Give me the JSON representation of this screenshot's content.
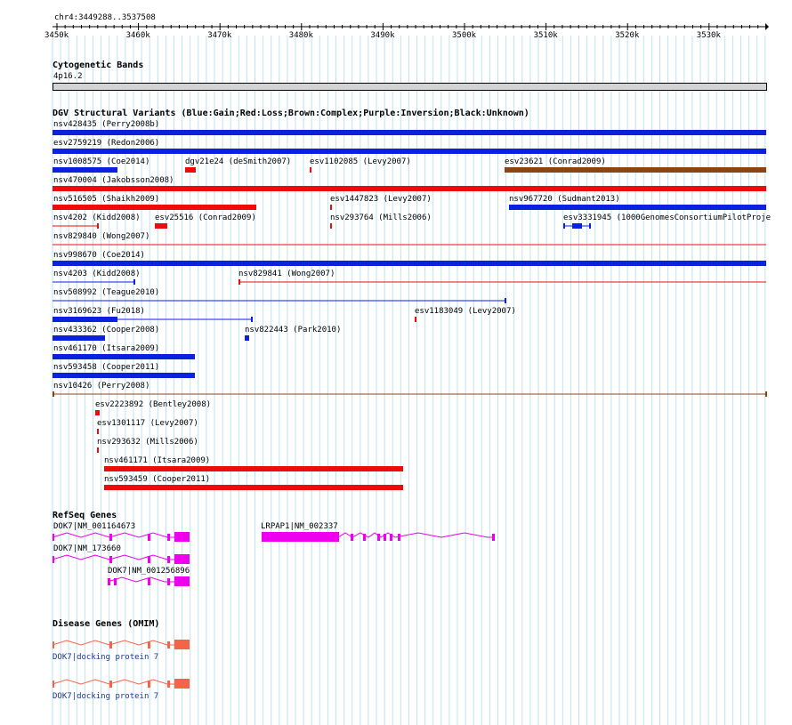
{
  "region": "chr4:3449288..3537508",
  "ruler": {
    "ticks": [
      "3450k",
      "3460k",
      "3470k",
      "3480k",
      "3490k",
      "3500k",
      "3510k",
      "3520k",
      "3530k"
    ]
  },
  "cytoband": {
    "title": "Cytogenetic Bands",
    "band": "4p16.2"
  },
  "dgv": {
    "title": "DGV Structural Variants (Blue:Gain;Red:Loss;Brown:Complex;Purple:Inversion;Black:Unknown)",
    "legend_colors": {
      "gain": "#0a22e0",
      "loss": "#ee0b0b",
      "complex": "#8b4513",
      "inversion": "#800080",
      "unknown": "#000000"
    },
    "variants": [
      {
        "label": "nsv428435 (Perry2008b)",
        "type": "gain"
      },
      {
        "label": "esv2759219 (Redon2006)",
        "type": "gain"
      },
      {
        "label": "nsv1008575 (Coe2014)",
        "type": "gain"
      },
      {
        "label": "dgv21e24 (deSmith2007)",
        "type": "loss"
      },
      {
        "label": "esv1102085 (Levy2007)",
        "type": "loss"
      },
      {
        "label": "esv23621 (Conrad2009)",
        "type": "complex"
      },
      {
        "label": "nsv470004 (Jakobsson2008)",
        "type": "loss"
      },
      {
        "label": "nsv516505 (Shaikh2009)",
        "type": "loss"
      },
      {
        "label": "esv1447823 (Levy2007)",
        "type": "loss"
      },
      {
        "label": "nsv967720 (Sudmant2013)",
        "type": "gain"
      },
      {
        "label": "nsv4202 (Kidd2008)",
        "type": "loss"
      },
      {
        "label": "esv25516 (Conrad2009)",
        "type": "loss"
      },
      {
        "label": "nsv293764 (Mills2006)",
        "type": "loss"
      },
      {
        "label": "esv3331945 (1000GenomesConsortiumPilotProje",
        "type": "gain"
      },
      {
        "label": "nsv829840 (Wong2007)",
        "type": "loss"
      },
      {
        "label": "nsv998670 (Coe2014)",
        "type": "gain"
      },
      {
        "label": "nsv4203 (Kidd2008)",
        "type": "gain"
      },
      {
        "label": "nsv829841 (Wong2007)",
        "type": "loss"
      },
      {
        "label": "nsv508992 (Teague2010)",
        "type": "gain"
      },
      {
        "label": "nsv3169623 (Fu2018)",
        "type": "gain"
      },
      {
        "label": "esv1183049 (Levy2007)",
        "type": "loss"
      },
      {
        "label": "nsv433362 (Cooper2008)",
        "type": "gain"
      },
      {
        "label": "nsv822443 (Park2010)",
        "type": "gain"
      },
      {
        "label": "nsv461170 (Itsara2009)",
        "type": "gain"
      },
      {
        "label": "nsv593458 (Cooper2011)",
        "type": "gain"
      },
      {
        "label": "nsv10426 (Perry2008)",
        "type": "complex"
      },
      {
        "label": "esv2223892 (Bentley2008)",
        "type": "loss"
      },
      {
        "label": "esv1301117 (Levy2007)",
        "type": "loss"
      },
      {
        "label": "nsv293632 (Mills2006)",
        "type": "loss"
      },
      {
        "label": "nsv461171 (Itsara2009)",
        "type": "loss"
      },
      {
        "label": "nsv593459 (Cooper2011)",
        "type": "loss"
      }
    ]
  },
  "refseq": {
    "title": "RefSeq Genes",
    "color": "#ee00ee",
    "genes": [
      {
        "label": "DOK7|NM_001164673"
      },
      {
        "label": "LRPAP1|NM_002337"
      },
      {
        "label": "DOK7|NM_173660"
      },
      {
        "label": "DOK7|NM_001256896"
      }
    ]
  },
  "omim": {
    "title": "Disease Genes (OMIM)",
    "color": "#f36548",
    "genes": [
      {
        "label": "DOK7|docking protein 7"
      },
      {
        "label": "DOK7|docking protein 7"
      }
    ]
  }
}
